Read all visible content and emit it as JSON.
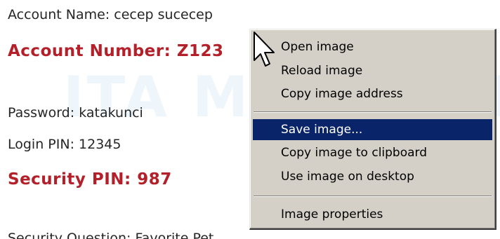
{
  "background": {
    "watermark": "ITA MEDIA OIE"
  },
  "account": {
    "name_label": "Account Name:",
    "name_value": "cecep sucecep",
    "number_label": "Account Number:",
    "number_value": "Z123",
    "password_label": "Password:",
    "password_value": "katakunci",
    "login_pin_label": "Login PIN:",
    "login_pin_value": "12345",
    "security_pin_label": "Security PIN:",
    "security_pin_value": "987",
    "security_question_label": "Security Question:",
    "security_question_value": "Favorite Pet"
  },
  "context_menu": {
    "items": [
      {
        "label": "Open image"
      },
      {
        "label": "Reload image"
      },
      {
        "label": "Copy image address"
      },
      {
        "label": "Save image...",
        "highlighted": true
      },
      {
        "label": "Copy image to clipboard"
      },
      {
        "label": "Use image on desktop"
      },
      {
        "label": "Image properties"
      }
    ]
  },
  "colors": {
    "highlight": "#0a246a",
    "menu_background": "#d4d0c8",
    "accent_red": "#b3202a",
    "text": "#262626"
  },
  "icons": {
    "cursor": "mouse-pointer-icon"
  }
}
